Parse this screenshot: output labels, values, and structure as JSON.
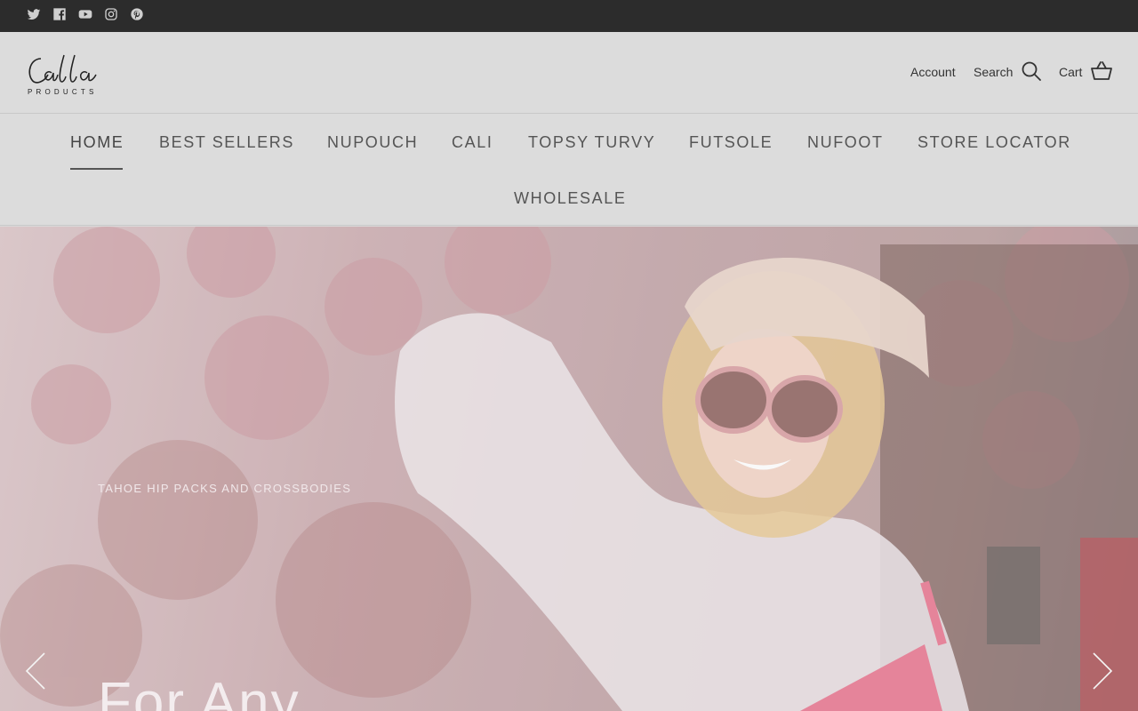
{
  "social": [
    {
      "name": "twitter-icon"
    },
    {
      "name": "facebook-icon"
    },
    {
      "name": "youtube-icon"
    },
    {
      "name": "instagram-icon"
    },
    {
      "name": "pinterest-icon"
    }
  ],
  "header": {
    "logo_text": "Calla",
    "logo_subtext": "PRODUCTS",
    "account_label": "Account",
    "search_label": "Search",
    "cart_label": "Cart"
  },
  "nav": {
    "items": [
      {
        "label": "HOME",
        "active": true
      },
      {
        "label": "BEST SELLERS"
      },
      {
        "label": "NUPOUCH"
      },
      {
        "label": "CALI"
      },
      {
        "label": "TOPSY TURVY"
      },
      {
        "label": "FUTSOLE"
      },
      {
        "label": "NUFOOT"
      },
      {
        "label": "STORE LOCATOR"
      },
      {
        "label": "WHOLESALE"
      }
    ]
  },
  "hero": {
    "kicker": "TAHOE HIP PACKS AND CROSSBODIES",
    "title": "For Any"
  },
  "colors": {
    "topbar": "#2c2c2c",
    "header_bg": "#dcdcdc",
    "nav_text": "#555555"
  }
}
